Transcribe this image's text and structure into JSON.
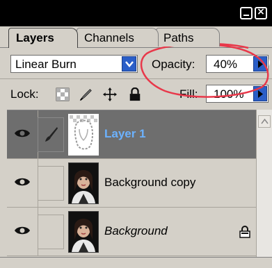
{
  "tabs": {
    "layers": "Layers",
    "channels": "Channels",
    "paths": "Paths"
  },
  "blend": {
    "mode": "Linear Burn"
  },
  "opacity": {
    "label": "Opacity:",
    "value": "40%"
  },
  "lock": {
    "label": "Lock:"
  },
  "fill": {
    "label": "Fill:",
    "value": "100%"
  },
  "layers": [
    {
      "name": "Layer 1",
      "selected": true,
      "visible": true
    },
    {
      "name": "Background copy",
      "selected": false,
      "visible": true
    },
    {
      "name": "Background",
      "selected": false,
      "visible": true,
      "locked": true
    }
  ],
  "colors": {
    "highlight_ellipse": "#e8384a",
    "selected_layer_bg": "#6e6e6e",
    "selected_layer_text": "#6cb2ff",
    "button_blue": "#2a5ec8"
  }
}
